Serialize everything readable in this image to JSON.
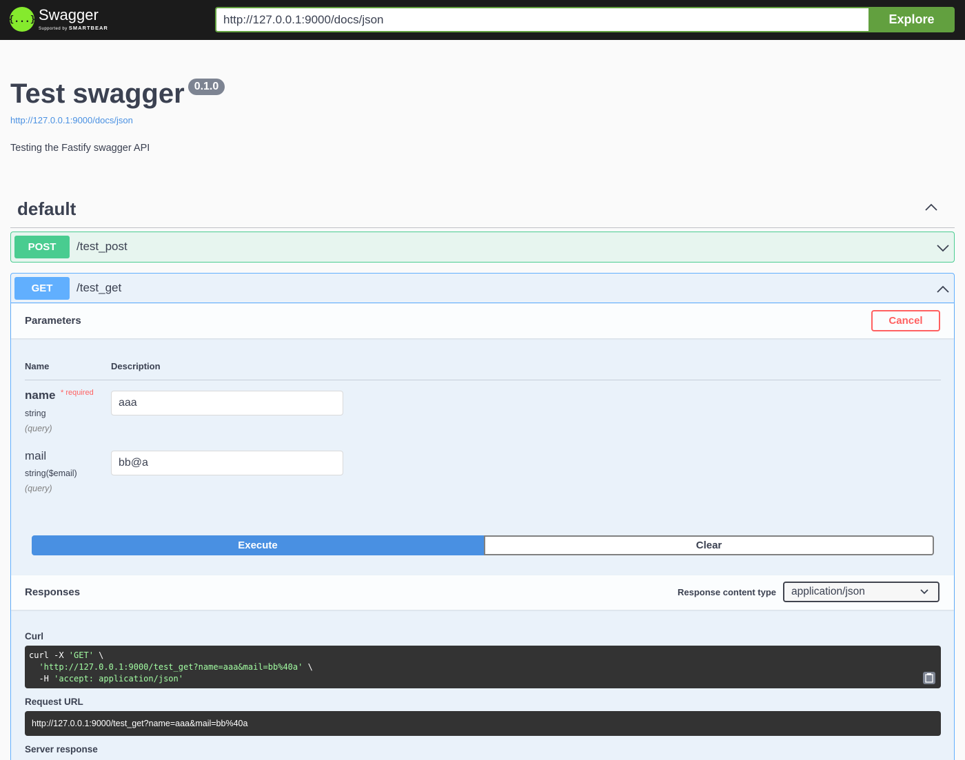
{
  "topbar": {
    "logo_title": "Swagger",
    "logo_sub_prefix": "Supported by",
    "logo_sub_brand": "SMARTBEAR",
    "logo_icon_text": "{...}",
    "url_value": "http://127.0.0.1:9000/docs/json",
    "explore_label": "Explore"
  },
  "info": {
    "title": "Test swagger",
    "version": "0.1.0",
    "spec_url": "http://127.0.0.1:9000/docs/json",
    "description": "Testing the Fastify swagger API"
  },
  "tag": {
    "name": "default"
  },
  "operations": [
    {
      "method": "POST",
      "path": "/test_post"
    },
    {
      "method": "GET",
      "path": "/test_get"
    }
  ],
  "parameters": {
    "title": "Parameters",
    "cancel_label": "Cancel",
    "col_name": "Name",
    "col_desc": "Description",
    "items": [
      {
        "name": "name",
        "required_mark": "*",
        "required_label": "required",
        "type": "string",
        "in": "(query)",
        "value": "aaa"
      },
      {
        "name": "mail",
        "type": "string($email)",
        "in": "(query)",
        "value": "bb@a"
      }
    ]
  },
  "actions": {
    "execute_label": "Execute",
    "clear_label": "Clear"
  },
  "responses": {
    "title": "Responses",
    "content_type_label": "Response content type",
    "content_type_value": "application/json",
    "curl_label": "Curl",
    "curl_line1_cmd": "curl -X ",
    "curl_line1_str": "'GET'",
    "curl_line1_end": " \\",
    "curl_line2_str": "'http://127.0.0.1:9000/test_get?name=aaa&mail=bb%40a'",
    "curl_line2_end": " \\",
    "curl_line3_cmd": "-H ",
    "curl_line3_str": "'accept: application/json'",
    "request_url_label": "Request URL",
    "request_url": "http://127.0.0.1:9000/test_get?name=aaa&mail=bb%40a",
    "server_response_label": "Server response"
  },
  "colors": {
    "topbar_bg": "#1b1b1b",
    "logo_green": "#85ea2d",
    "explore_green": "#62a03f",
    "post_green": "#49cc90",
    "get_blue": "#61affe",
    "execute_blue": "#4990e2",
    "cancel_red": "#ff6060"
  },
  "icons": [
    "swagger-logo-icon",
    "chevron-up-icon",
    "chevron-down-icon",
    "copy-to-clipboard-icon"
  ]
}
